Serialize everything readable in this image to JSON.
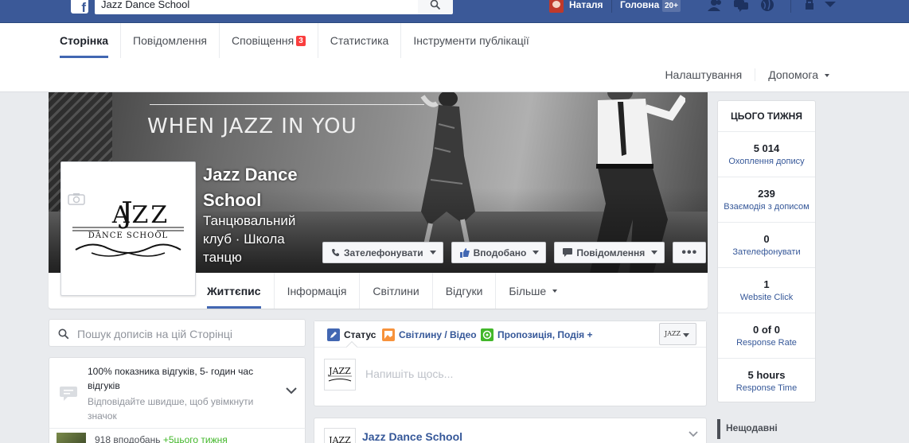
{
  "topbar": {
    "logo": "f",
    "search_value": "Jazz Dance School",
    "user_name": "Наталя",
    "home_label": "Головна",
    "home_badge": "20+"
  },
  "pagenav": {
    "tabs": [
      {
        "label": "Сторінка"
      },
      {
        "label": "Повідомлення"
      },
      {
        "label": "Сповіщення",
        "badge": "3"
      },
      {
        "label": "Статистика"
      },
      {
        "label": "Інструменти публікації"
      }
    ],
    "settings_label": "Налаштування",
    "help_label": "Допомога"
  },
  "cover": {
    "slogan": "WHEN JAZZ IN YOU",
    "page_name": "Jazz Dance School",
    "category": "Танцювальний клуб · Школа танцю",
    "logo_word": "JAZZ",
    "logo_sub": "DANCE SCHOOL",
    "buttons": {
      "call": "Зателефонувати",
      "liked": "Вподобано",
      "message": "Повідомлення",
      "more": "•••"
    },
    "subtabs": [
      "Життєпис",
      "Інформація",
      "Світлини",
      "Відгуки",
      "Більше"
    ]
  },
  "left": {
    "search_placeholder": "Пошук дописів на цій Сторінці",
    "response_title": "100% показника відгуків, 5- годин час відгуків",
    "response_hint": "Відповідайте швидше, щоб увімкнути значок",
    "likes_text": "918 вподобань",
    "likes_week": "+5цього тижня"
  },
  "composer": {
    "tab_status": "Статус",
    "tab_photo": "Світлину / Відео",
    "tab_offer": "Пропозиція, Подія +",
    "placeholder": "Напишіть щось..."
  },
  "post": {
    "page_name": "Jazz Dance School"
  },
  "stats": {
    "title": "ЦЬОГО ТИЖНЯ",
    "items": [
      {
        "value": "5 014",
        "label": "Охоплення допису"
      },
      {
        "value": "239",
        "label": "Взаємодія з дописом"
      },
      {
        "value": "0",
        "label": "Зателефонувати"
      },
      {
        "value": "1",
        "label": "Website Click"
      },
      {
        "value": "0 of 0",
        "label": "Response Rate"
      },
      {
        "value": "5 hours",
        "label": "Response Time"
      }
    ],
    "recent_label": "Нещодавні"
  },
  "colors": {
    "brand": "#3b5998",
    "link": "#365899",
    "accent": "#4267b2",
    "notif": "#fa3e3e"
  }
}
